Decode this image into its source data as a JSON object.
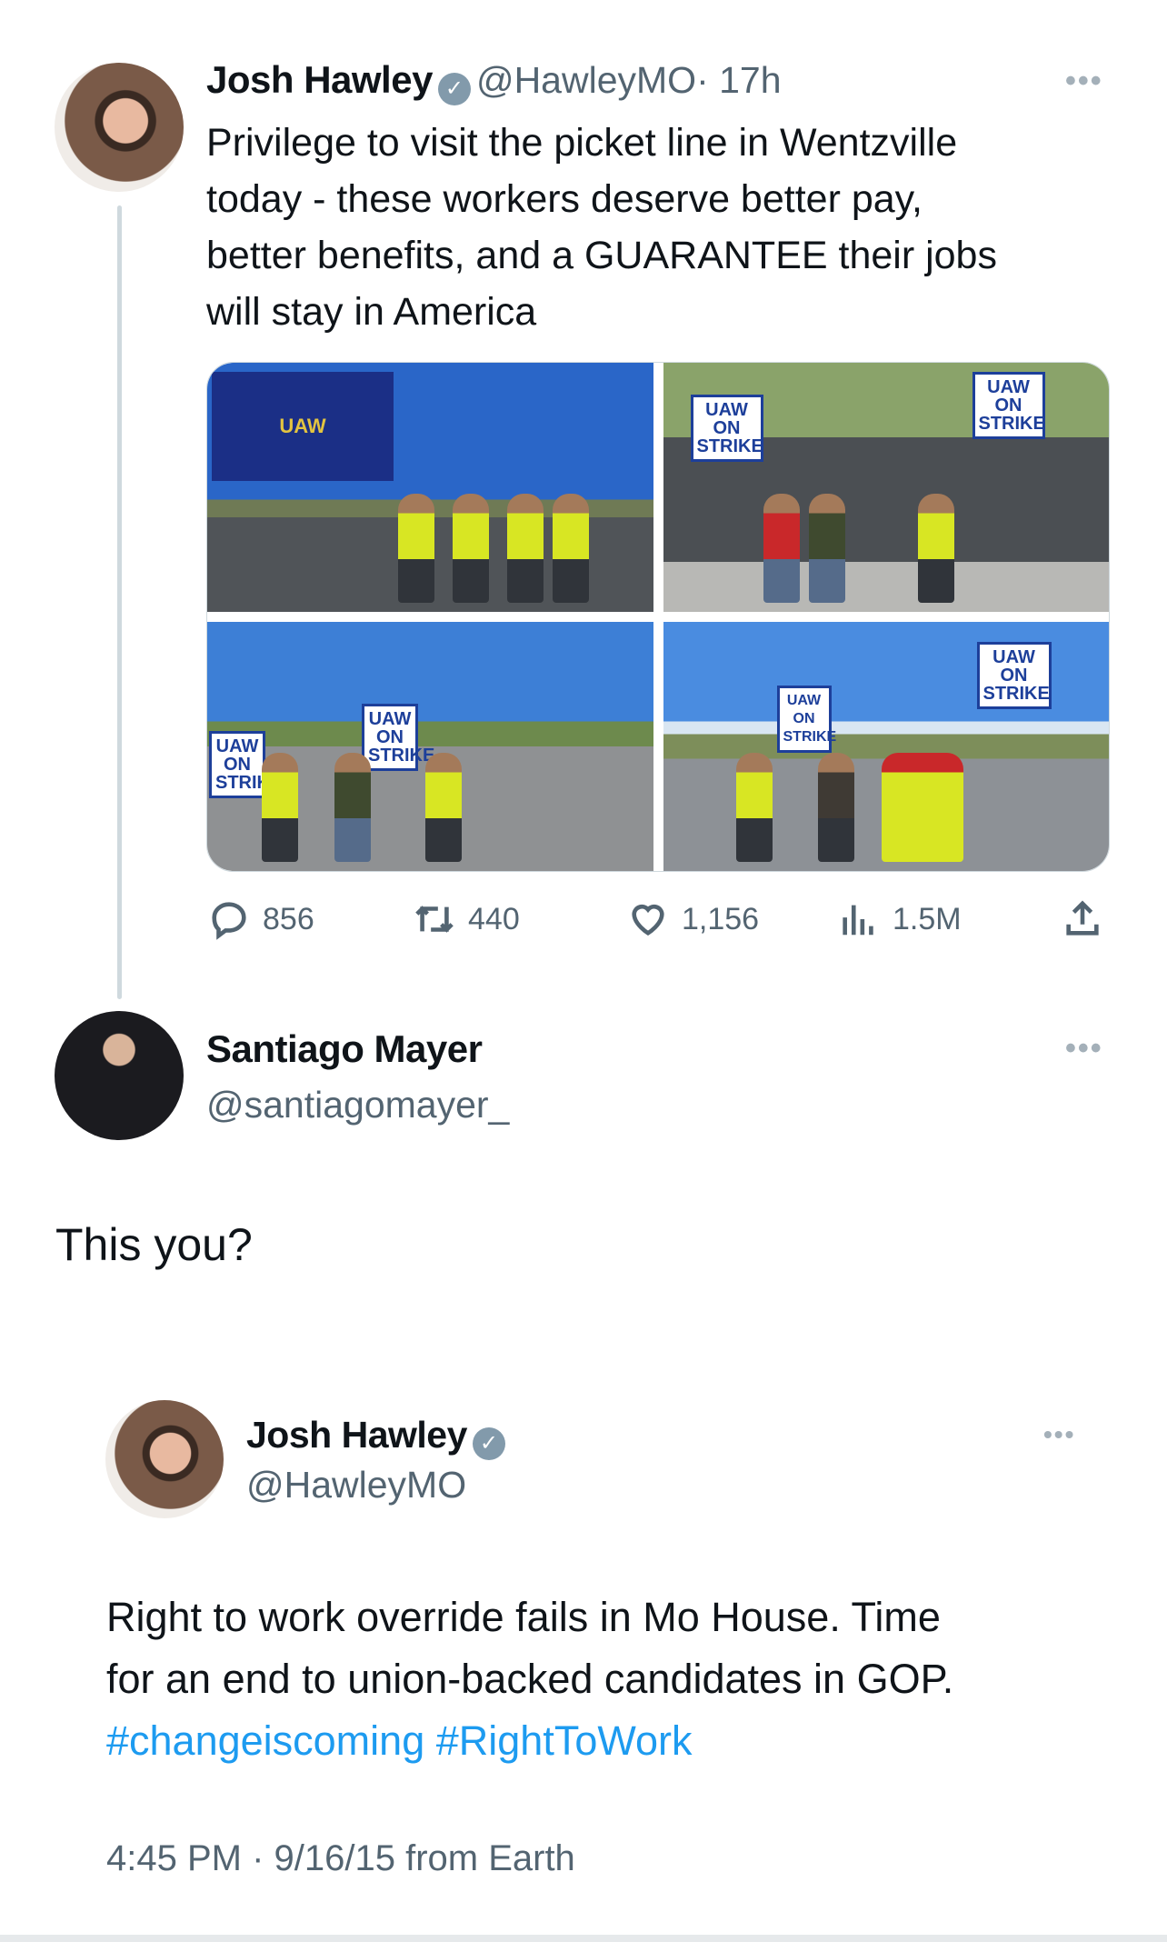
{
  "tweet": {
    "name": "Josh Hawley",
    "handle": "@HawleyMO",
    "time": "· 17h",
    "text_lines": [
      "Privilege to visit the picket line in Wentzville",
      "today - these workers deserve better pay,",
      "better benefits, and a GUARANTEE their jobs",
      "will stay in America"
    ],
    "images": {
      "flag": "UAW",
      "sign": "UAW ON STRIKE"
    },
    "actions": {
      "replies": "856",
      "reposts": "440",
      "likes": "1,156",
      "views": "1.5M"
    }
  },
  "reply": {
    "name": "Santiago Mayer",
    "handle": "@santiagomayer_",
    "text": "This you?"
  },
  "quoted": {
    "name": "Josh Hawley",
    "handle": "@HawleyMO",
    "text_lines": [
      "Right to work override fails in Mo House. Time",
      "for an end to union-backed candidates in GOP."
    ],
    "hashtags": [
      "#changeiscoming",
      "#RightToWork"
    ],
    "timestamp": "4:45 PM · 9/16/15 from Earth"
  },
  "colors": {
    "link": "#1d9bf0",
    "secondary": "#536471",
    "verified": "#829aab"
  }
}
